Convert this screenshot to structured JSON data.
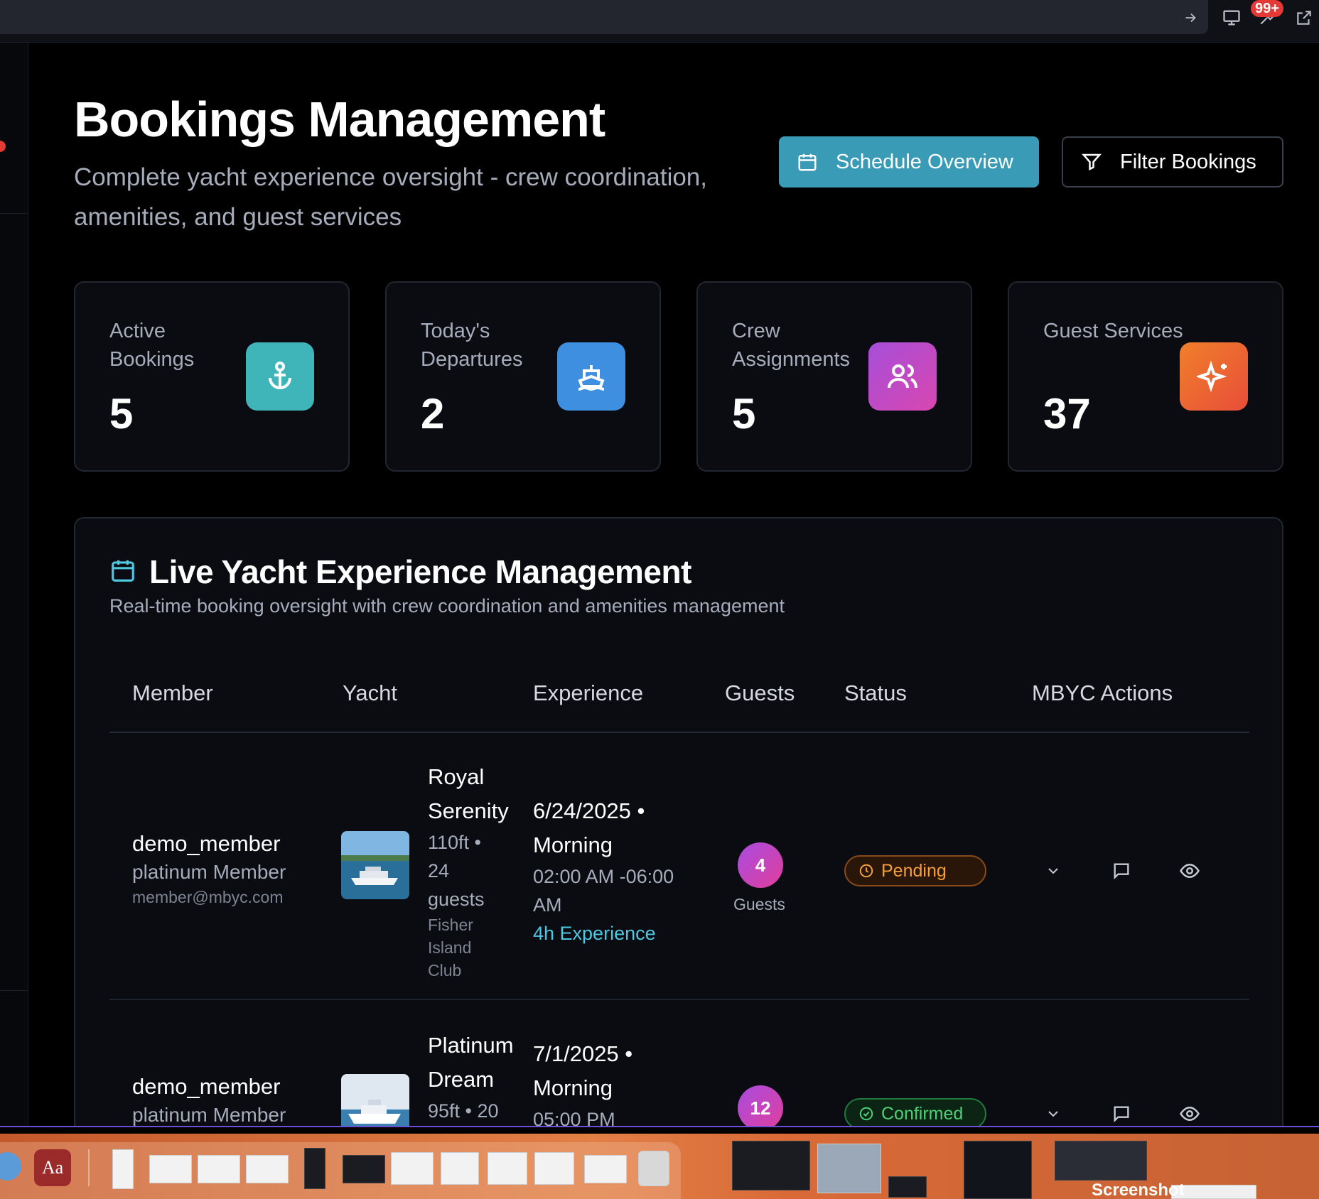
{
  "browser": {
    "notification_count": "99+"
  },
  "header": {
    "title": "Bookings Management",
    "subtitle": "Complete yacht experience oversight - crew coordination, amenities, and guest services",
    "schedule_button": "Schedule Overview",
    "filter_button": "Filter Bookings"
  },
  "stats": [
    {
      "label": "Active Bookings",
      "value": "5",
      "icon": "anchor-icon",
      "color": "#3fb5b9"
    },
    {
      "label": "Today's Departures",
      "value": "2",
      "icon": "ship-icon",
      "color": "#3f8fe0"
    },
    {
      "label": "Crew Assignments",
      "value": "5",
      "icon": "users-icon",
      "color": "#b24fd9"
    },
    {
      "label": "Guest Services",
      "value": "37",
      "icon": "sparkles-icon",
      "color": "#ee6030"
    }
  ],
  "panel": {
    "title": "Live Yacht Experience Management",
    "description": "Real-time booking oversight with crew coordination and amenities management"
  },
  "table": {
    "headers": [
      "Member",
      "Yacht",
      "Experience",
      "Guests",
      "Status",
      "MBYC Actions"
    ],
    "rows": [
      {
        "member_name": "demo_member",
        "member_tier": "platinum Member",
        "member_email": "member@mbyc.com",
        "yacht_name": "Royal Serenity",
        "yacht_spec": "110ft • 24 guests",
        "yacht_location": "Fisher Island Club",
        "date": "6/24/2025 • Morning",
        "time": "02:00 AM -06:00 AM",
        "duration": "4h Experience",
        "guests": "4",
        "guests_label": "Guests",
        "status": "Pending"
      },
      {
        "member_name": "demo_member",
        "member_tier": "platinum Member",
        "yacht_name": "Platinum Dream",
        "yacht_spec": "95ft • 20",
        "date": "7/1/2025 • Morning",
        "time": "05:00 PM",
        "guests": "12",
        "status": "Confirmed"
      }
    ]
  },
  "dock": {
    "dictionary_label": "Aa",
    "screenshot_label": "Screenshot"
  }
}
